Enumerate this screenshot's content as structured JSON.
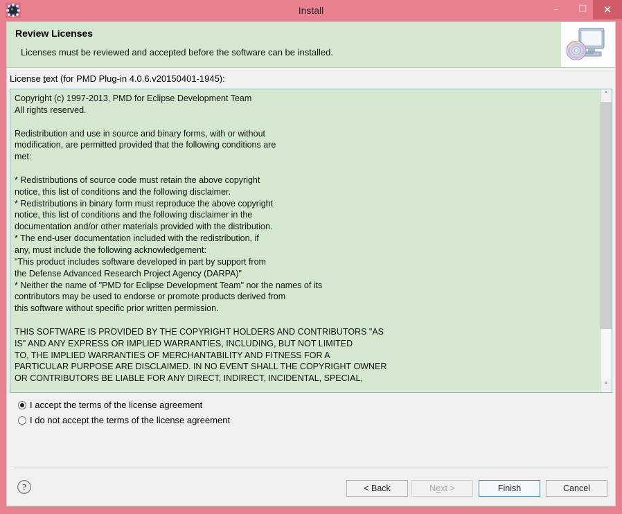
{
  "window": {
    "title": "Install",
    "icon": "gear-icon",
    "controls": {
      "minimize": "–",
      "maximize": "❐",
      "close": "✕"
    },
    "colors": {
      "frame": "#e8818f",
      "close_button": "#cf5c68",
      "banner": "#d3e8cf",
      "body": "#f0f0f0",
      "focus_border": "#3f8fd2"
    }
  },
  "header": {
    "title": "Review Licenses",
    "subtitle": "Licenses must be reviewed and accepted before the software can be installed.",
    "image": "computer-cd-icon"
  },
  "license": {
    "label_before": "License ",
    "label_mnemonic": "t",
    "label_after": "ext (for PMD Plug-in 4.0.6.v20150401-1945):",
    "text": "Copyright (c) 1997-2013, PMD for Eclipse Development Team\nAll rights reserved.\n\nRedistribution and use in source and binary forms, with or without\nmodification, are permitted provided that the following conditions are\nmet:\n\n* Redistributions of source code must retain the above copyright\nnotice, this list of conditions and the following disclaimer.\n* Redistributions in binary form must reproduce the above copyright\nnotice, this list of conditions and the following disclaimer in the\ndocumentation and/or other materials provided with the distribution.\n* The end-user documentation included with the redistribution, if\nany, must include the following acknowledgement:\n\"This product includes software developed in part by support from\nthe Defense Advanced Research Project Agency (DARPA)\"\n* Neither the name of \"PMD for Eclipse Development Team\" nor the names of its\ncontributors may be used to endorse or promote products derived from\nthis software without specific prior written permission.\n\nTHIS SOFTWARE IS PROVIDED BY THE COPYRIGHT HOLDERS AND CONTRIBUTORS \"AS\nIS\" AND ANY EXPRESS OR IMPLIED WARRANTIES, INCLUDING, BUT NOT LIMITED\nTO, THE IMPLIED WARRANTIES OF MERCHANTABILITY AND FITNESS FOR A\nPARTICULAR PURPOSE ARE DISCLAIMED. IN NO EVENT SHALL THE COPYRIGHT OWNER\nOR CONTRIBUTORS BE LIABLE FOR ANY DIRECT, INDIRECT, INCIDENTAL, SPECIAL,",
    "scrollbar": {
      "up_arrow": "˄",
      "down_arrow": "˅"
    }
  },
  "options": {
    "accept": "I accept the terms of the license agreement",
    "decline": "I do not accept the terms of the license agreement",
    "selected": "accept"
  },
  "buttons": {
    "help": "?",
    "back": "< Back",
    "next_before": "N",
    "next_mnemonic": "e",
    "next_after": "xt >",
    "next_full": "Next >",
    "finish": "Finish",
    "cancel": "Cancel"
  }
}
